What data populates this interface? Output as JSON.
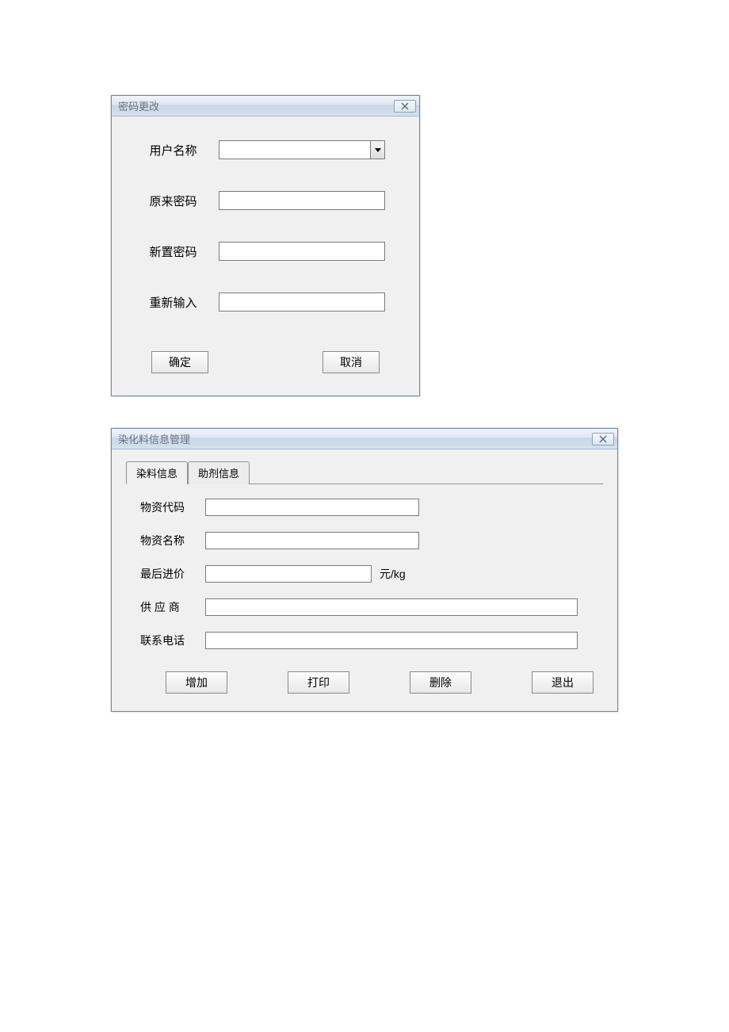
{
  "window1": {
    "title": "密码更改",
    "fields": {
      "username_label": "用户名称",
      "username_value": "",
      "oldpw_label": "原来密码",
      "oldpw_value": "",
      "newpw_label": "新置密码",
      "newpw_value": "",
      "confirm_label": "重新输入",
      "confirm_value": ""
    },
    "buttons": {
      "ok": "确定",
      "cancel": "取消"
    }
  },
  "window2": {
    "title": "染化料信息管理",
    "tabs": {
      "tab1": "染料信息",
      "tab2": "助剂信息"
    },
    "fields": {
      "code_label": "物资代码",
      "code_value": "",
      "name_label": "物资名称",
      "name_value": "",
      "price_label": "最后进价",
      "price_value": "",
      "price_unit": "元/kg",
      "supplier_label": "供 应 商",
      "supplier_value": "",
      "phone_label": "联系电话",
      "phone_value": ""
    },
    "buttons": {
      "add": "增加",
      "print": "打印",
      "delete": "删除",
      "exit": "退出"
    }
  }
}
